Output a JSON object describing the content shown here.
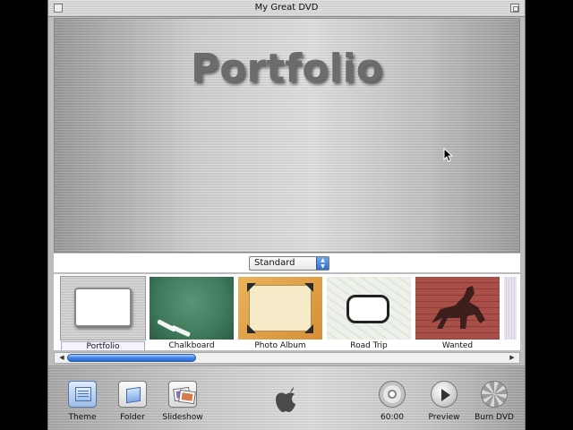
{
  "window": {
    "title": "My Great DVD"
  },
  "preview": {
    "title": "Portfolio"
  },
  "theme_selector": {
    "selected": "Standard"
  },
  "themes": [
    {
      "label": "Portfolio",
      "selected": true
    },
    {
      "label": "Chalkboard",
      "selected": false
    },
    {
      "label": "Photo Album",
      "selected": false
    },
    {
      "label": "Road Trip",
      "selected": false
    },
    {
      "label": "Wanted",
      "selected": false
    }
  ],
  "toolbar": {
    "theme_label": "Theme",
    "folder_label": "Folder",
    "slideshow_label": "Slideshow",
    "duration_label": "60:00",
    "preview_label": "Preview",
    "burn_label": "Burn DVD"
  },
  "colors": {
    "accent": "#3f84e5",
    "chalkboard": "#3f7a5c",
    "album": "#e0a24a",
    "wanted": "#a34a43"
  },
  "icons": {
    "theme": "theme-panel-icon",
    "folder": "folder-icon",
    "slideshow": "slideshow-icon",
    "disc": "disc-icon",
    "preview": "play-icon",
    "burn": "burn-icon",
    "logo": "apple-logo"
  }
}
